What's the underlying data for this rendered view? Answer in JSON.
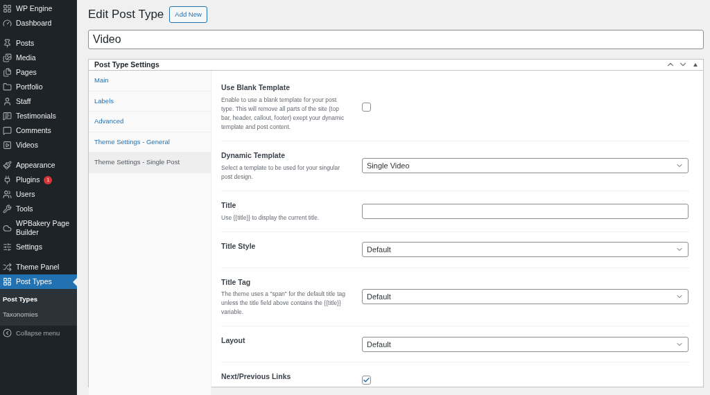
{
  "sidebar": {
    "groups": [
      [
        {
          "label": "WP Engine",
          "selected": false
        },
        {
          "label": "Dashboard",
          "selected": false
        }
      ],
      [
        {
          "label": "Posts",
          "selected": false
        },
        {
          "label": "Media",
          "selected": false
        },
        {
          "label": "Pages",
          "selected": false
        },
        {
          "label": "Portfolio",
          "selected": false
        },
        {
          "label": "Staff",
          "selected": false
        },
        {
          "label": "Testimonials",
          "selected": false
        },
        {
          "label": "Comments",
          "selected": false
        },
        {
          "label": "Videos",
          "selected": false
        }
      ],
      [
        {
          "label": "Appearance",
          "selected": false
        },
        {
          "label": "Plugins",
          "selected": false,
          "badge": "1"
        },
        {
          "label": "Users",
          "selected": false
        },
        {
          "label": "Tools",
          "selected": false
        },
        {
          "label": "WPBakery Page Builder",
          "selected": false
        },
        {
          "label": "Settings",
          "selected": false
        }
      ],
      [
        {
          "label": "Theme Panel",
          "selected": false
        },
        {
          "label": "Post Types",
          "selected": true
        }
      ]
    ],
    "submenu": [
      {
        "label": "Post Types",
        "selected": true
      },
      {
        "label": "Taxonomies",
        "selected": false
      }
    ],
    "collapse": "Collapse menu"
  },
  "page": {
    "title": "Edit Post Type",
    "add_new": "Add New",
    "post_title": "Video"
  },
  "panel": {
    "title": "Post Type Settings",
    "tabs": [
      {
        "label": "Main",
        "selected": false
      },
      {
        "label": "Labels",
        "selected": false
      },
      {
        "label": "Advanced",
        "selected": false
      },
      {
        "label": "Theme Settings - General",
        "selected": false
      },
      {
        "label": "Theme Settings - Single Post",
        "selected": true
      }
    ],
    "fields": [
      {
        "kind": "checkbox",
        "label": "Use Blank Template",
        "description": "Enable to use a blank template for your post type. This will remove all parts of the site (top bar, header, callout, footer) exept your dynamic template and post content.",
        "checked": false
      },
      {
        "kind": "select",
        "label": "Dynamic Template",
        "description": "Select a template to be used for your singular post design.",
        "value": "Single Video"
      },
      {
        "kind": "text",
        "label": "Title",
        "description": "Use {{title}} to display the current title."
      },
      {
        "kind": "select",
        "label": "Title Style",
        "value": "Default"
      },
      {
        "kind": "select",
        "label": "Title Tag",
        "description": "The theme uses a \"span\" for the default title tag unless the title field above contains the {{title}} variable.",
        "value": "Default"
      },
      {
        "kind": "select",
        "label": "Layout",
        "value": "Default"
      },
      {
        "kind": "checkbox",
        "label": "Next/Previous Links",
        "checked": true
      }
    ]
  }
}
